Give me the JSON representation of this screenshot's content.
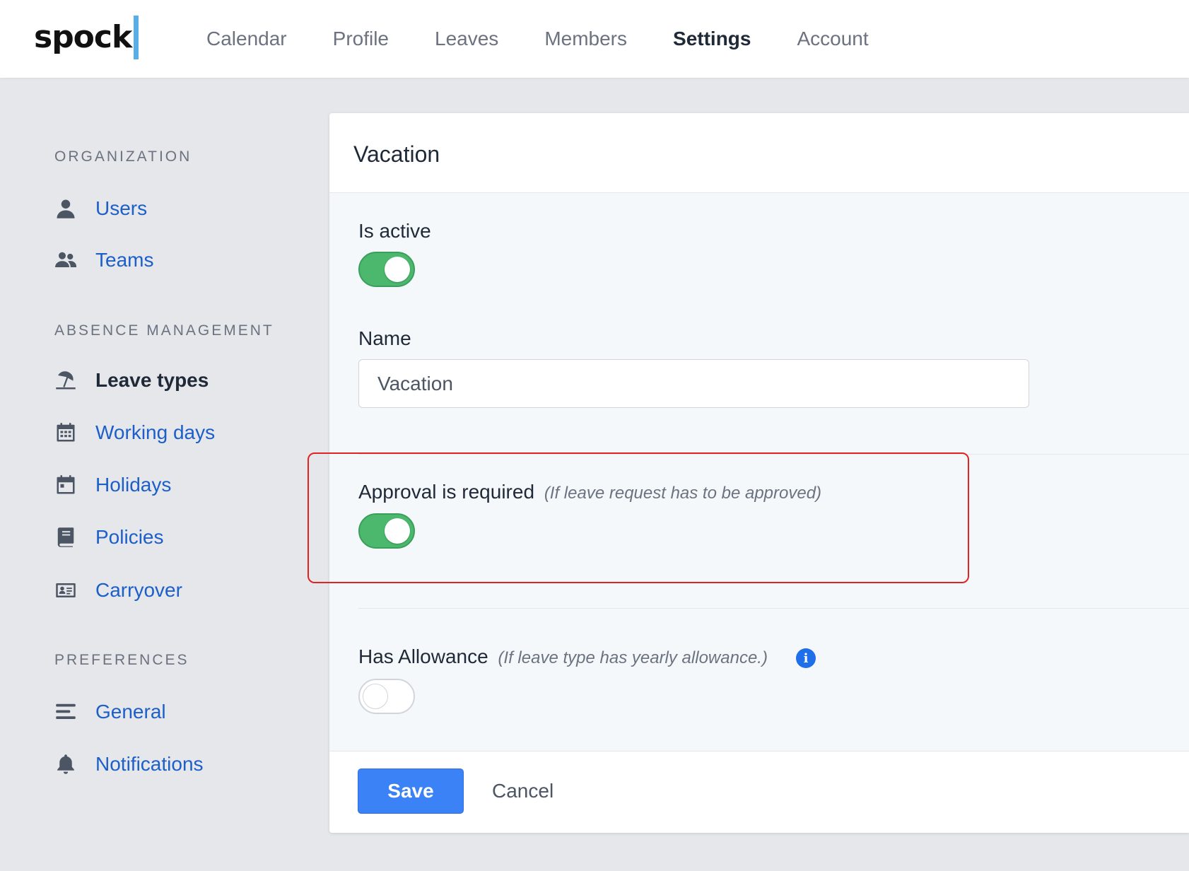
{
  "app": {
    "logo": "spock"
  },
  "nav": {
    "items": [
      {
        "label": "Calendar"
      },
      {
        "label": "Profile"
      },
      {
        "label": "Leaves"
      },
      {
        "label": "Members"
      },
      {
        "label": "Settings"
      },
      {
        "label": "Account"
      }
    ],
    "active": "Settings"
  },
  "sidebar": {
    "organization": {
      "title": "ORGANIZATION",
      "items": [
        {
          "label": "Users",
          "icon": "user-icon"
        },
        {
          "label": "Teams",
          "icon": "users-icon"
        }
      ]
    },
    "absence": {
      "title": "ABSENCE MANAGEMENT",
      "items": [
        {
          "label": "Leave types",
          "icon": "umbrella-beach-icon"
        },
        {
          "label": "Working days",
          "icon": "calendar-grid-icon"
        },
        {
          "label": "Holidays",
          "icon": "calendar-icon"
        },
        {
          "label": "Policies",
          "icon": "book-icon"
        },
        {
          "label": "Carryover",
          "icon": "id-card-icon"
        }
      ]
    },
    "preferences": {
      "title": "PREFERENCES",
      "items": [
        {
          "label": "General",
          "icon": "align-left-icon"
        },
        {
          "label": "Notifications",
          "icon": "bell-icon"
        }
      ]
    },
    "active": "Leave types"
  },
  "form": {
    "title": "Vacation",
    "is_active": {
      "label": "Is active",
      "value": true
    },
    "name": {
      "label": "Name",
      "value": "Vacation"
    },
    "approval": {
      "label": "Approval is required",
      "hint": "(If leave request has to be approved)",
      "value": true
    },
    "allowance": {
      "label": "Has Allowance",
      "hint": "(If leave type has yearly allowance.)",
      "value": false
    },
    "save_label": "Save",
    "cancel_label": "Cancel"
  },
  "colors": {
    "accent": "#3b82f6",
    "toggle_on": "#4bb86d",
    "link": "#1d5fc9",
    "highlight": "#e02424"
  }
}
